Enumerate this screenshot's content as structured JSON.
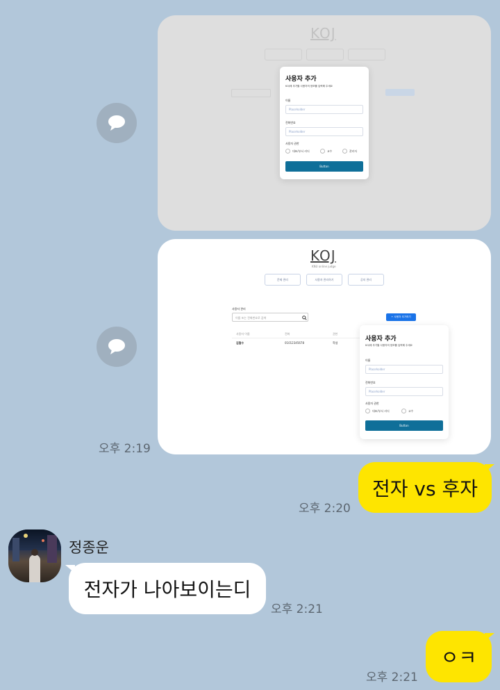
{
  "screenshot1": {
    "logo": "KOJ",
    "modal": {
      "title": "사용자 추가",
      "desc": "KOJ에 추가할 사용자의 정보를 입력해 주세요",
      "name_label": "이름",
      "name_placeholder": "Placeholder",
      "phone_label": "전화번호",
      "phone_placeholder": "Placeholder",
      "role_label": "사용자 권한",
      "roles": [
        "대표/부서 리더",
        "교수",
        "관리자"
      ],
      "submit": "Button"
    }
  },
  "screenshot2": {
    "logo": "KOJ",
    "sublogo": "KNU online judge",
    "nav": [
      "문제 관리",
      "사용자 관리하기",
      "공지 관리"
    ],
    "section_label": "사용자 관리",
    "search_placeholder": "이름 또는 전화번호로 검색",
    "add_button": "+ 사용자 추가하기",
    "table_headers": [
      "사용자 이름",
      "전화",
      "권한"
    ],
    "table_row": [
      "김철수",
      "01012345678",
      "학생"
    ],
    "modal": {
      "title": "사용자 추가",
      "desc": "KOJ에 추가할 사용자의 정보를 입력해 주세요",
      "name_label": "이름",
      "name_placeholder": "Placeholder",
      "phone_label": "전화번호",
      "phone_placeholder": "Placeholder",
      "role_label": "사용자 권한",
      "roles": [
        "대표/부서 리더",
        "교수"
      ],
      "submit": "Button"
    }
  },
  "messages": {
    "time_images": "오후 2:19",
    "msg1": {
      "text": "전자 vs 후자",
      "time": "오후 2:20"
    },
    "sender": "정종운",
    "msg2": {
      "text": "전자가 나아보이는디",
      "time": "오후 2:21"
    },
    "msg3": {
      "text": "ㅇㅋ",
      "time": "오후 2:21"
    }
  },
  "colors": {
    "background": "#b2c7da",
    "outgoing_bubble": "#fee500",
    "incoming_bubble": "#ffffff",
    "modal_button": "#0f6f99",
    "add_button": "#1a73e8"
  }
}
